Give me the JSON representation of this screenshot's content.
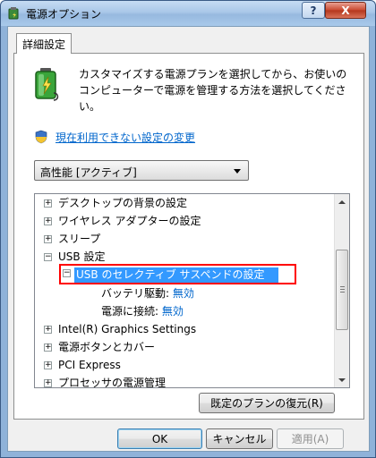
{
  "window": {
    "title": "電源オプション",
    "help_label": "?",
    "close_label": "X"
  },
  "tab": {
    "label": "詳細設定"
  },
  "description": "カスタマイズする電源プランを選択してから、お使いのコンピューターで電源を管理する方法を選択してください。",
  "change_link": "現在利用できない設定の変更",
  "plan_select": {
    "value": "高性能 [アクティブ]"
  },
  "tree": {
    "items": [
      {
        "label": "デスクトップの背景の設定",
        "expander": "+"
      },
      {
        "label": "ワイヤレス アダプターの設定",
        "expander": "+"
      },
      {
        "label": "スリープ",
        "expander": "+"
      },
      {
        "label": "USB 設定",
        "expander": "−"
      },
      {
        "label": "USB のセレクティブ サスペンドの設定",
        "expander": "−",
        "selected": true
      },
      {
        "label": "バッテリ駆動:",
        "value": "無効"
      },
      {
        "label": "電源に接続:",
        "value": "無効"
      },
      {
        "label": "Intel(R) Graphics Settings",
        "expander": "+"
      },
      {
        "label": "電源ボタンとカバー",
        "expander": "+"
      },
      {
        "label": "PCI Express",
        "expander": "+"
      },
      {
        "label": "プロセッサの電源管理",
        "expander": "+"
      }
    ]
  },
  "buttons": {
    "restore": "既定のプランの復元(R)",
    "ok": "OK",
    "cancel": "キャンセル",
    "apply": "適用(A)"
  },
  "colors": {
    "link": "#0066cc",
    "selection": "#3399ff",
    "highlight_border": "#ff0000"
  },
  "icons": {
    "app": "power-options-icon",
    "battery": "battery-plug-icon",
    "shield": "uac-shield-icon"
  }
}
